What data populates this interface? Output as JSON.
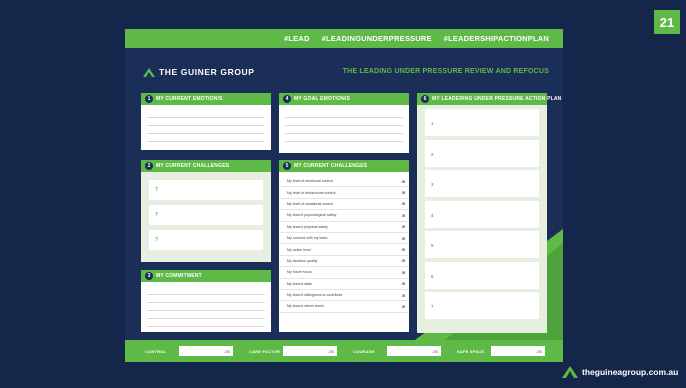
{
  "page_number": "21",
  "hashtags": [
    "#LEAD",
    "#LEADINGUNDERPRESSURE",
    "#LEADERSHIPACTIONPLAN"
  ],
  "brand": {
    "logo_text": "THE GUINER GROUP",
    "website": "theguineagroup.com.au"
  },
  "subtitle": "THE LEADING UNDER PRESSURE REVIEW AND REFOCUS",
  "colors": {
    "green": "#5fb947",
    "navy": "#1b2e57",
    "background": "#14274a"
  },
  "cards": {
    "current_emotions": {
      "number": "1",
      "title": "MY CURRENT EMOTION/S"
    },
    "current_challenges": {
      "number": "2",
      "title": "MY CURRENT CHALLENGES",
      "questions": [
        "?",
        "?",
        "?"
      ]
    },
    "commitment": {
      "number": "3",
      "title": "MY COMMITMENT"
    },
    "goal_emotions": {
      "number": "4",
      "title": "MY GOAL EMOTION/S"
    },
    "current_challenges_ratings": {
      "number": "5",
      "title": "MY CURRENT CHALLENGES",
      "rows": [
        {
          "label": "My level of emotional control",
          "value": "/5"
        },
        {
          "label": "My level of behavioural control",
          "value": "/5"
        },
        {
          "label": "My level of situational control",
          "value": "/5"
        },
        {
          "label": "My team's psychological safety",
          "value": "/5"
        },
        {
          "label": "My team's physical safety",
          "value": "/5"
        },
        {
          "label": "My connect with my team",
          "value": "/5"
        },
        {
          "label": "My action level",
          "value": "/5"
        },
        {
          "label": "My decision quality",
          "value": "/5"
        },
        {
          "label": "My future focus",
          "value": "/5"
        },
        {
          "label": "My team's state",
          "value": "/5"
        },
        {
          "label": "My team's willingness to contribute",
          "value": "/5"
        },
        {
          "label": "My team's stress levels",
          "value": "/5"
        }
      ]
    },
    "action_plan": {
      "number": "6",
      "title": "MY LEADERING UNDER PRESSURE ACTION PLAN",
      "steps": [
        "1",
        "2",
        "3",
        "4",
        "5",
        "6",
        "7"
      ]
    }
  },
  "footer": [
    {
      "label": "CONTROL",
      "value": "/25"
    },
    {
      "label": "CARE FACTOR",
      "value": "/25"
    },
    {
      "label": "COURAGE",
      "value": "/25"
    },
    {
      "label": "SAFE SPACE",
      "value": "/25"
    }
  ]
}
